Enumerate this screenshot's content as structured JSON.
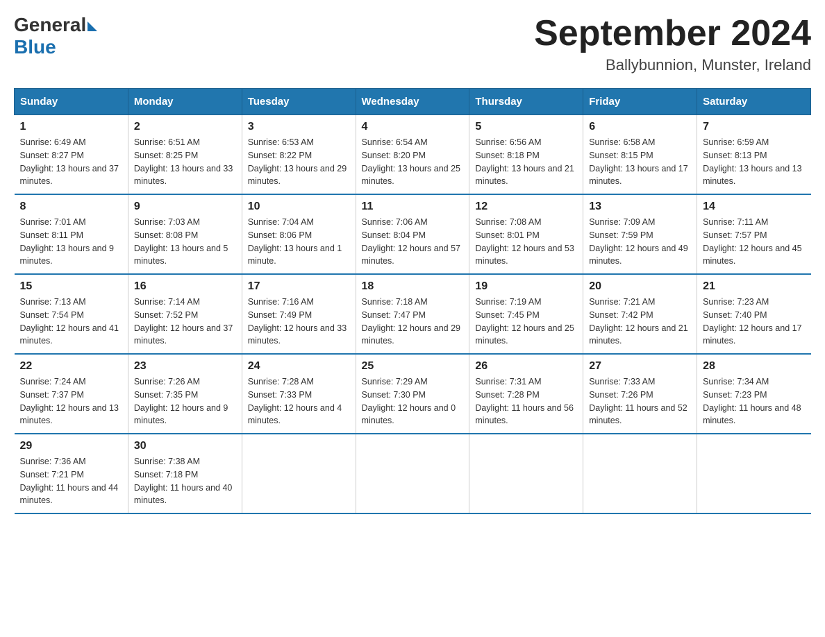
{
  "header": {
    "logo_general": "General",
    "logo_blue": "Blue",
    "month_year": "September 2024",
    "location": "Ballybunnion, Munster, Ireland"
  },
  "days_of_week": [
    "Sunday",
    "Monday",
    "Tuesday",
    "Wednesday",
    "Thursday",
    "Friday",
    "Saturday"
  ],
  "weeks": [
    [
      {
        "day": "1",
        "sunrise": "6:49 AM",
        "sunset": "8:27 PM",
        "daylight": "13 hours and 37 minutes."
      },
      {
        "day": "2",
        "sunrise": "6:51 AM",
        "sunset": "8:25 PM",
        "daylight": "13 hours and 33 minutes."
      },
      {
        "day": "3",
        "sunrise": "6:53 AM",
        "sunset": "8:22 PM",
        "daylight": "13 hours and 29 minutes."
      },
      {
        "day": "4",
        "sunrise": "6:54 AM",
        "sunset": "8:20 PM",
        "daylight": "13 hours and 25 minutes."
      },
      {
        "day": "5",
        "sunrise": "6:56 AM",
        "sunset": "8:18 PM",
        "daylight": "13 hours and 21 minutes."
      },
      {
        "day": "6",
        "sunrise": "6:58 AM",
        "sunset": "8:15 PM",
        "daylight": "13 hours and 17 minutes."
      },
      {
        "day": "7",
        "sunrise": "6:59 AM",
        "sunset": "8:13 PM",
        "daylight": "13 hours and 13 minutes."
      }
    ],
    [
      {
        "day": "8",
        "sunrise": "7:01 AM",
        "sunset": "8:11 PM",
        "daylight": "13 hours and 9 minutes."
      },
      {
        "day": "9",
        "sunrise": "7:03 AM",
        "sunset": "8:08 PM",
        "daylight": "13 hours and 5 minutes."
      },
      {
        "day": "10",
        "sunrise": "7:04 AM",
        "sunset": "8:06 PM",
        "daylight": "13 hours and 1 minute."
      },
      {
        "day": "11",
        "sunrise": "7:06 AM",
        "sunset": "8:04 PM",
        "daylight": "12 hours and 57 minutes."
      },
      {
        "day": "12",
        "sunrise": "7:08 AM",
        "sunset": "8:01 PM",
        "daylight": "12 hours and 53 minutes."
      },
      {
        "day": "13",
        "sunrise": "7:09 AM",
        "sunset": "7:59 PM",
        "daylight": "12 hours and 49 minutes."
      },
      {
        "day": "14",
        "sunrise": "7:11 AM",
        "sunset": "7:57 PM",
        "daylight": "12 hours and 45 minutes."
      }
    ],
    [
      {
        "day": "15",
        "sunrise": "7:13 AM",
        "sunset": "7:54 PM",
        "daylight": "12 hours and 41 minutes."
      },
      {
        "day": "16",
        "sunrise": "7:14 AM",
        "sunset": "7:52 PM",
        "daylight": "12 hours and 37 minutes."
      },
      {
        "day": "17",
        "sunrise": "7:16 AM",
        "sunset": "7:49 PM",
        "daylight": "12 hours and 33 minutes."
      },
      {
        "day": "18",
        "sunrise": "7:18 AM",
        "sunset": "7:47 PM",
        "daylight": "12 hours and 29 minutes."
      },
      {
        "day": "19",
        "sunrise": "7:19 AM",
        "sunset": "7:45 PM",
        "daylight": "12 hours and 25 minutes."
      },
      {
        "day": "20",
        "sunrise": "7:21 AM",
        "sunset": "7:42 PM",
        "daylight": "12 hours and 21 minutes."
      },
      {
        "day": "21",
        "sunrise": "7:23 AM",
        "sunset": "7:40 PM",
        "daylight": "12 hours and 17 minutes."
      }
    ],
    [
      {
        "day": "22",
        "sunrise": "7:24 AM",
        "sunset": "7:37 PM",
        "daylight": "12 hours and 13 minutes."
      },
      {
        "day": "23",
        "sunrise": "7:26 AM",
        "sunset": "7:35 PM",
        "daylight": "12 hours and 9 minutes."
      },
      {
        "day": "24",
        "sunrise": "7:28 AM",
        "sunset": "7:33 PM",
        "daylight": "12 hours and 4 minutes."
      },
      {
        "day": "25",
        "sunrise": "7:29 AM",
        "sunset": "7:30 PM",
        "daylight": "12 hours and 0 minutes."
      },
      {
        "day": "26",
        "sunrise": "7:31 AM",
        "sunset": "7:28 PM",
        "daylight": "11 hours and 56 minutes."
      },
      {
        "day": "27",
        "sunrise": "7:33 AM",
        "sunset": "7:26 PM",
        "daylight": "11 hours and 52 minutes."
      },
      {
        "day": "28",
        "sunrise": "7:34 AM",
        "sunset": "7:23 PM",
        "daylight": "11 hours and 48 minutes."
      }
    ],
    [
      {
        "day": "29",
        "sunrise": "7:36 AM",
        "sunset": "7:21 PM",
        "daylight": "11 hours and 44 minutes."
      },
      {
        "day": "30",
        "sunrise": "7:38 AM",
        "sunset": "7:18 PM",
        "daylight": "11 hours and 40 minutes."
      },
      null,
      null,
      null,
      null,
      null
    ]
  ],
  "labels": {
    "sunrise": "Sunrise:",
    "sunset": "Sunset:",
    "daylight": "Daylight:"
  }
}
